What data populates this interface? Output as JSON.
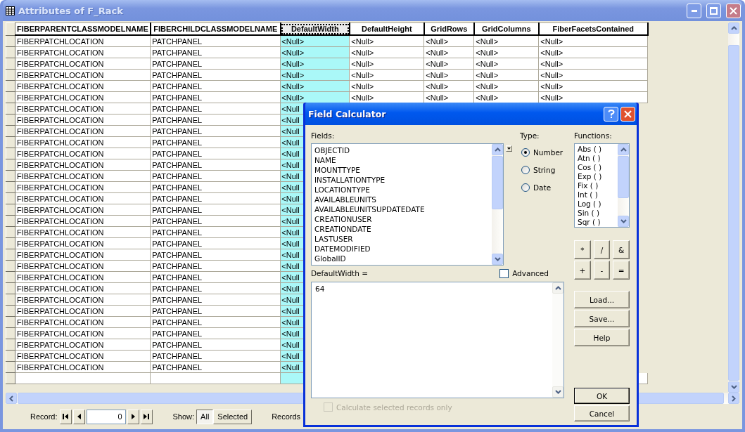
{
  "window": {
    "title": "Attributes of F_Rack"
  },
  "table": {
    "columns": [
      {
        "label": "FIBERPARENTCLASSMODELNAME",
        "selected": false
      },
      {
        "label": "FIBERCHILDCLASSMODELNAME",
        "selected": false
      },
      {
        "label": "DefaultWidth",
        "selected": true
      },
      {
        "label": "DefaultHeight",
        "selected": false
      },
      {
        "label": "GridRows",
        "selected": false
      },
      {
        "label": "GridColumns",
        "selected": false
      },
      {
        "label": "FiberFacetsContained",
        "selected": false
      }
    ],
    "rows": [
      {
        "cells": [
          "FIBERPATCHLOCATION",
          "PATCHPANEL",
          "<Null>",
          "<Null>",
          "<Null>",
          "<Null>",
          "<Null>"
        ]
      },
      {
        "cells": [
          "FIBERPATCHLOCATION",
          "PATCHPANEL",
          "<Null>",
          "<Null>",
          "<Null>",
          "<Null>",
          "<Null>"
        ]
      },
      {
        "cells": [
          "FIBERPATCHLOCATION",
          "PATCHPANEL",
          "<Null>",
          "<Null>",
          "<Null>",
          "<Null>",
          "<Null>"
        ]
      },
      {
        "cells": [
          "FIBERPATCHLOCATION",
          "PATCHPANEL",
          "<Null>",
          "<Null>",
          "<Null>",
          "<Null>",
          "<Null>"
        ]
      },
      {
        "cells": [
          "FIBERPATCHLOCATION",
          "PATCHPANEL",
          "<Null>",
          "<Null>",
          "<Null>",
          "<Null>",
          "<Null>"
        ]
      },
      {
        "cells": [
          "FIBERPATCHLOCATION",
          "PATCHPANEL",
          "<Null>",
          "<Null>",
          "<Null>",
          "<Null>",
          "<Null>"
        ]
      },
      {
        "cells": [
          "FIBERPATCHLOCATION",
          "PATCHPANEL",
          "<Null"
        ]
      },
      {
        "cells": [
          "FIBERPATCHLOCATION",
          "PATCHPANEL",
          "<Null"
        ]
      },
      {
        "cells": [
          "FIBERPATCHLOCATION",
          "PATCHPANEL",
          "<Null"
        ]
      },
      {
        "cells": [
          "FIBERPATCHLOCATION",
          "PATCHPANEL",
          "<Null"
        ]
      },
      {
        "cells": [
          "FIBERPATCHLOCATION",
          "PATCHPANEL",
          "<Null"
        ]
      },
      {
        "cells": [
          "FIBERPATCHLOCATION",
          "PATCHPANEL",
          "<Null"
        ]
      },
      {
        "cells": [
          "FIBERPATCHLOCATION",
          "PATCHPANEL",
          "<Null"
        ]
      },
      {
        "cells": [
          "FIBERPATCHLOCATION",
          "PATCHPANEL",
          "<Null"
        ]
      },
      {
        "cells": [
          "FIBERPATCHLOCATION",
          "PATCHPANEL",
          "<Null"
        ]
      },
      {
        "cells": [
          "FIBERPATCHLOCATION",
          "PATCHPANEL",
          "<Null"
        ]
      },
      {
        "cells": [
          "FIBERPATCHLOCATION",
          "PATCHPANEL",
          "<Null"
        ]
      },
      {
        "cells": [
          "FIBERPATCHLOCATION",
          "PATCHPANEL",
          "<Null"
        ]
      },
      {
        "cells": [
          "FIBERPATCHLOCATION",
          "PATCHPANEL",
          "<Null"
        ]
      },
      {
        "cells": [
          "FIBERPATCHLOCATION",
          "PATCHPANEL",
          "<Null"
        ]
      },
      {
        "cells": [
          "FIBERPATCHLOCATION",
          "PATCHPANEL",
          "<Null"
        ]
      },
      {
        "cells": [
          "FIBERPATCHLOCATION",
          "PATCHPANEL",
          "<Null"
        ]
      },
      {
        "cells": [
          "FIBERPATCHLOCATION",
          "PATCHPANEL",
          "<Null"
        ]
      },
      {
        "cells": [
          "FIBERPATCHLOCATION",
          "PATCHPANEL",
          "<Null"
        ]
      },
      {
        "cells": [
          "FIBERPATCHLOCATION",
          "PATCHPANEL",
          "<Null"
        ]
      },
      {
        "cells": [
          "FIBERPATCHLOCATION",
          "PATCHPANEL",
          "<Null"
        ]
      },
      {
        "cells": [
          "FIBERPATCHLOCATION",
          "PATCHPANEL",
          "<Null"
        ]
      },
      {
        "cells": [
          "FIBERPATCHLOCATION",
          "PATCHPANEL",
          "<Null"
        ]
      },
      {
        "cells": [
          "FIBERPATCHLOCATION",
          "PATCHPANEL",
          "<Null"
        ]
      },
      {
        "cells": [
          "FIBERPATCHLOCATION",
          "PATCHPANEL",
          "<Null"
        ]
      }
    ]
  },
  "record_nav": {
    "label": "Record:",
    "value": "0"
  },
  "show": {
    "label": "Show:",
    "options": [
      {
        "label": "All",
        "selected": true
      },
      {
        "label": "Selected",
        "selected": false
      }
    ]
  },
  "records_label": "Records",
  "dialog": {
    "title": "Field Calculator",
    "fields_label": "Fields:",
    "fields": [
      "OBJECTID",
      "NAME",
      "MOUNTTYPE",
      "INSTALLATIONTYPE",
      "LOCATIONTYPE",
      "AVAILABLEUNITS",
      "AVAILABLEUNITSUPDATEDATE",
      "CREATIONUSER",
      "CREATIONDATE",
      "LASTUSER",
      "DATEMODIFIED",
      "GlobalID"
    ],
    "type_label": "Type:",
    "types": [
      {
        "label": "Number",
        "selected": true
      },
      {
        "label": "String",
        "selected": false
      },
      {
        "label": "Date",
        "selected": false
      }
    ],
    "functions_label": "Functions:",
    "functions": [
      "Abs ( )",
      "Atn ( )",
      "Cos ( )",
      "Exp ( )",
      "Fix ( )",
      "Int ( )",
      "Log ( )",
      "Sin ( )",
      "Sqr ( )"
    ],
    "operators": [
      "*",
      "/",
      "&",
      "+",
      "-",
      "="
    ],
    "expression_label": "DefaultWidth =",
    "advanced": {
      "label": "Advanced",
      "checked": false
    },
    "expression": "64",
    "buttons": [
      "Load...",
      "Save...",
      "Help"
    ],
    "selected_only": {
      "label": "Calculate selected records only",
      "checked": false,
      "disabled": true
    },
    "actions": [
      {
        "label": "OK",
        "default": true
      },
      {
        "label": "Cancel",
        "default": false
      }
    ]
  }
}
